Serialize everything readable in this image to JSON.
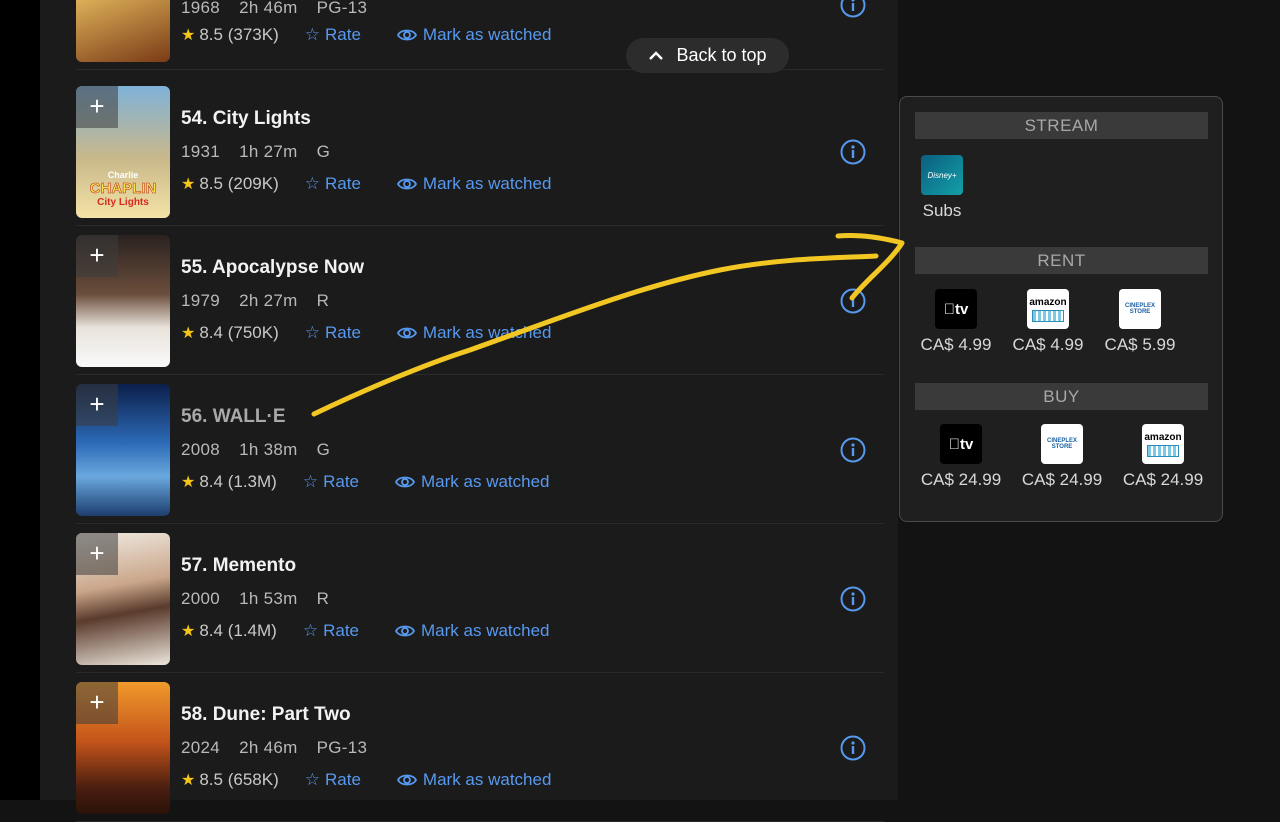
{
  "back_to_top": "Back to top",
  "rows": [
    {
      "title": "",
      "year": "1968",
      "runtime": "2h 46m",
      "rating_cert": "PG-13",
      "rating": "8.5",
      "votes": "(373K)",
      "rate": "Rate",
      "watched": "Mark as watched"
    },
    {
      "title": "54. City Lights",
      "year": "1931",
      "runtime": "1h 27m",
      "rating_cert": "G",
      "rating": "8.5",
      "votes": "(209K)",
      "rate": "Rate",
      "watched": "Mark as watched",
      "poster_text": [
        "Charlie",
        "CHAPLIN",
        "City Lights"
      ]
    },
    {
      "title": "55. Apocalypse Now",
      "year": "1979",
      "runtime": "2h 27m",
      "rating_cert": "R",
      "rating": "8.4",
      "votes": "(750K)",
      "rate": "Rate",
      "watched": "Mark as watched"
    },
    {
      "title": "56. WALL·E",
      "year": "2008",
      "runtime": "1h 38m",
      "rating_cert": "G",
      "rating": "8.4",
      "votes": "(1.3M)",
      "rate": "Rate",
      "watched": "Mark as watched"
    },
    {
      "title": "57. Memento",
      "year": "2000",
      "runtime": "1h 53m",
      "rating_cert": "R",
      "rating": "8.4",
      "votes": "(1.4M)",
      "rate": "Rate",
      "watched": "Mark as watched"
    },
    {
      "title": "58. Dune: Part Two",
      "year": "2024",
      "runtime": "2h 46m",
      "rating_cert": "PG-13",
      "rating": "8.5",
      "votes": "(658K)",
      "rate": "Rate",
      "watched": "Mark as watched"
    }
  ],
  "providers": {
    "stream_label": "STREAM",
    "stream": [
      {
        "name": "Disney+",
        "logo_text": "Disney+",
        "price": "Subs"
      }
    ],
    "rent_label": "RENT",
    "rent": [
      {
        "name": "Apple TV",
        "logo_text": "tv",
        "price": "CA$ 4.99"
      },
      {
        "name": "Amazon",
        "logo_text": "amazon",
        "price": "CA$ 4.99"
      },
      {
        "name": "Cineplex Store",
        "logo_text": "CINEPLEX STORE",
        "price": "CA$ 5.99"
      }
    ],
    "buy_label": "BUY",
    "buy": [
      {
        "name": "Apple TV",
        "logo_text": "tv",
        "price": "CA$ 24.99"
      },
      {
        "name": "Cineplex Store",
        "logo_text": "CINEPLEX STORE",
        "price": "CA$ 24.99"
      },
      {
        "name": "Amazon",
        "logo_text": "amazon",
        "price": "CA$ 24.99"
      }
    ]
  },
  "annotation": {
    "color": "#f2c623"
  },
  "colors": {
    "accent": "#5799ef",
    "star": "#f5c518",
    "background": "#1b1b1b"
  }
}
